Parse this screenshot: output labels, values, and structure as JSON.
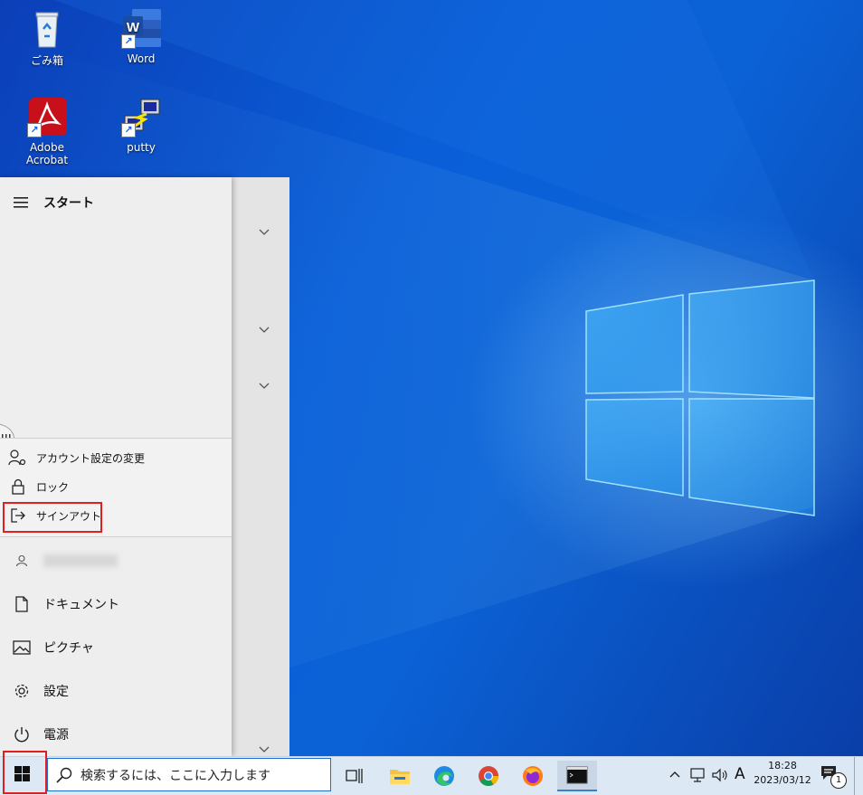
{
  "desktop": {
    "icons": [
      {
        "label": "ごみ箱",
        "icon": "recycle-bin-icon"
      },
      {
        "label": "Word",
        "icon": "word-icon"
      },
      {
        "label": "Adobe Acrobat",
        "icon": "acrobat-icon"
      },
      {
        "label": "putty",
        "icon": "putty-icon"
      }
    ]
  },
  "start_menu": {
    "title": "スタート",
    "user_menu": {
      "account_settings": "アカウント設定の変更",
      "lock": "ロック",
      "sign_out": "サインアウト"
    },
    "items": [
      {
        "label": "ドキュメント",
        "icon": "document-icon"
      },
      {
        "label": "ピクチャ",
        "icon": "pictures-icon"
      },
      {
        "label": "設定",
        "icon": "gear-icon"
      },
      {
        "label": "電源",
        "icon": "power-icon"
      }
    ]
  },
  "taskbar": {
    "search_placeholder": "検索するには、ここに入力します",
    "apps": [
      "task-view-icon",
      "file-explorer-icon",
      "edge-icon",
      "chrome-icon",
      "firefox-icon",
      "command-prompt-icon"
    ],
    "tray": {
      "ime": "A",
      "time": "18:28",
      "date": "2023/03/12",
      "notification_count": "1"
    }
  },
  "colors": {
    "highlight_box": "#e02020",
    "search_border": "#1c6fd0",
    "taskbar": "#dce8f4"
  }
}
